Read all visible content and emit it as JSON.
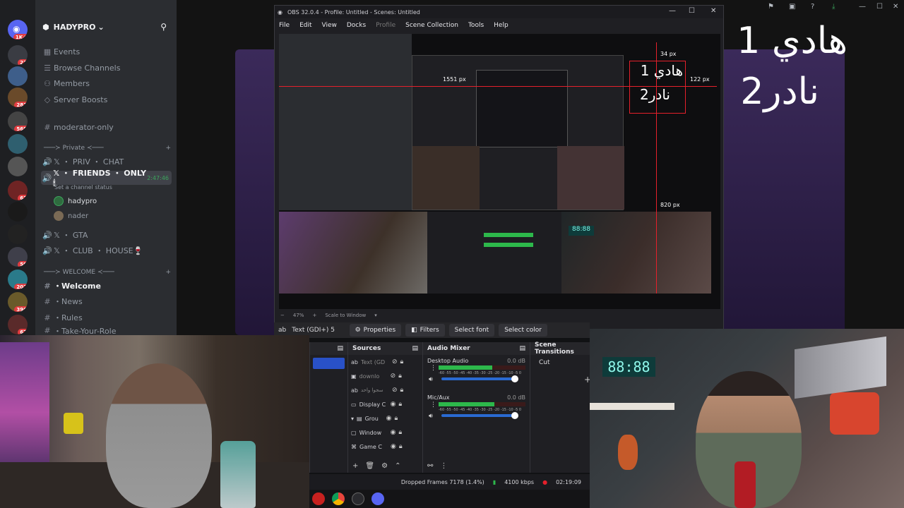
{
  "discord": {
    "badges": [
      "1K+",
      "23",
      "281",
      "568",
      "63",
      "59",
      "202",
      "396",
      "67"
    ],
    "server_name": "HADYPRO",
    "channels_top": [
      "Events",
      "Browse Channels",
      "Members",
      "Server Boosts"
    ],
    "channel_moderator": "moderator-only",
    "cat_private": "───≻ Private ≺───",
    "ch_priv_chat": "𝕏 ・ PRIV ・ CHAT",
    "ch_friends": "𝕏 ・ FRIENDS ・ ONLY 🕯",
    "ch_friends_time": "2:47:46",
    "ch_status": "Set a channel status",
    "voice_users": [
      "hadypro",
      "nader"
    ],
    "ch_gta": "𝕏 ・ GTA",
    "ch_club": "𝕏 ・ CLUB ・ HOUSE🍷",
    "cat_welcome": "───≻ WELCOME ≺───",
    "ch_welcome": "・Welcome",
    "ch_news": "・News",
    "ch_rules": "・Rules",
    "ch_take_role": "・Take-Your-Role"
  },
  "obs": {
    "title": "OBS 32.0.4 - Profile: Untitled - Scenes: Untitled",
    "menu": [
      "File",
      "Edit",
      "View",
      "Docks",
      "Profile",
      "Scene Collection",
      "Tools",
      "Help"
    ],
    "zoom": "47%",
    "scale_mode": "Scale to Window",
    "selected_source": "Text (GDI+) 5",
    "toolbar": {
      "properties": "Properties",
      "filters": "Filters",
      "select_font": "Select font",
      "select_color": "Select color"
    },
    "sources_title": "Sources",
    "sources": [
      "Text (GD",
      "downlo",
      "سجوا واحد",
      "Display C",
      "Grou",
      "Window",
      "Game C"
    ],
    "audio_title": "Audio Mixer",
    "audio": [
      {
        "name": "Desktop Audio",
        "db": "0.0 dB",
        "level": 0.62
      },
      {
        "name": "Mic/Aux",
        "db": "0.0 dB",
        "level": 0.64
      }
    ],
    "meter_scale": "-60 -55 -50 -45 -40 -35 -30 -25 -20 -15 -10 -5 0",
    "transitions_title": "Scene Transitions",
    "transition_value": "Cut",
    "status": {
      "dropped": "Dropped Frames 7178 (1.4%)",
      "bitrate": "4100 kbps",
      "time": "02:19:09"
    }
  },
  "overlay": {
    "text_line1": "هادي 1",
    "text_line2": "نادر2",
    "measure_top": "34 px",
    "measure_left": "1551 px",
    "measure_right": "122 px",
    "measure_bottom": "820 px"
  },
  "colors": {
    "discord_bg": "#2b2d31",
    "obs_bg": "#1f1f23",
    "accent": "#5865f2",
    "meter_green": "#2db84b",
    "red_guide": "#e5202b"
  }
}
